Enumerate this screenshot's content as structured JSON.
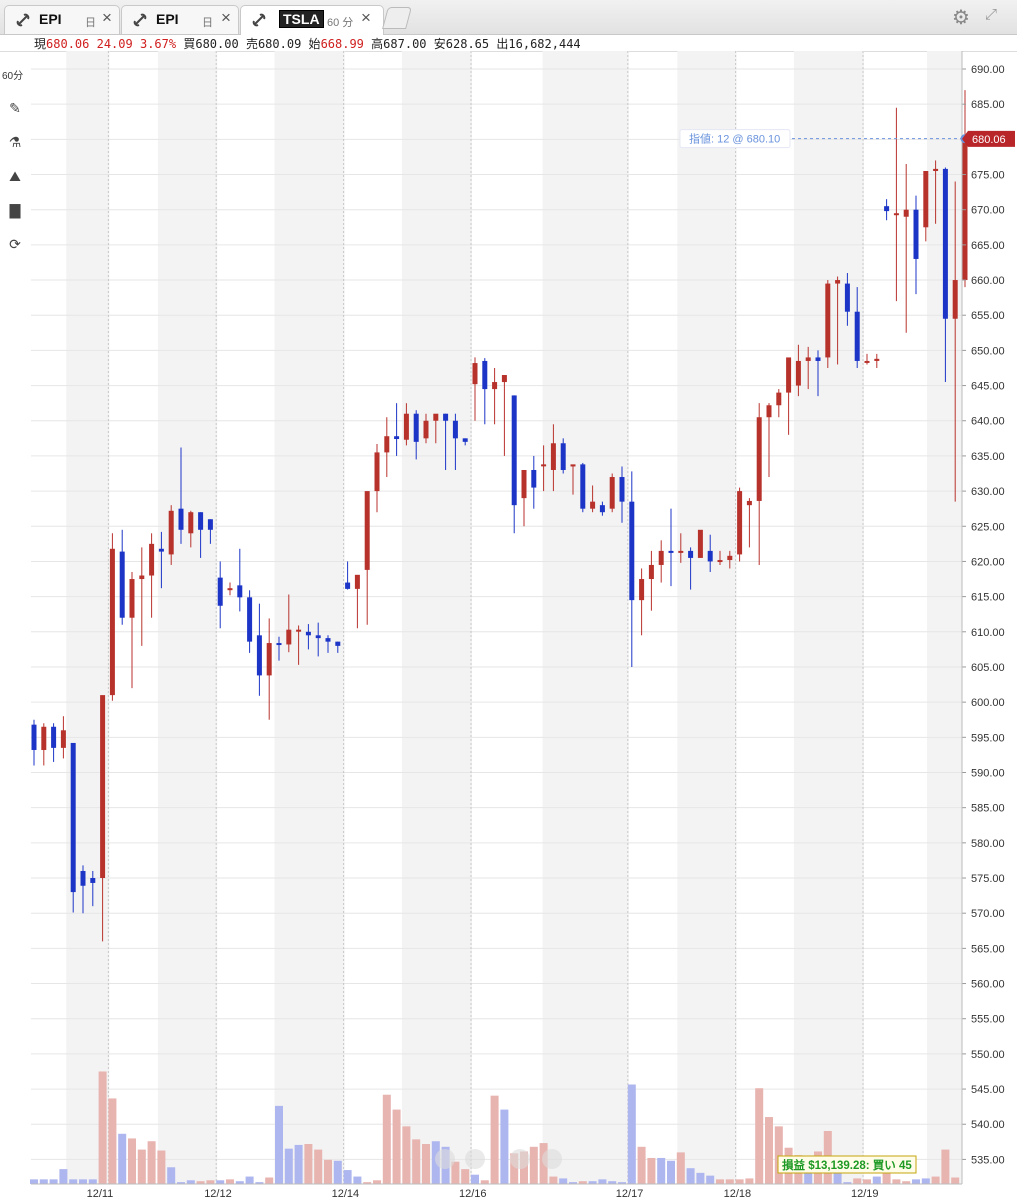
{
  "tabs": [
    {
      "symbol": "EPI",
      "timeframe": "日",
      "active": false
    },
    {
      "symbol": "EPI",
      "timeframe": "日",
      "active": false
    },
    {
      "symbol": "TSLA",
      "timeframe": "60 分",
      "active": true
    }
  ],
  "quote": {
    "last_label": "現",
    "last": "680.06",
    "change": "24.09",
    "change_pct": "3.67%",
    "bid_label": "買",
    "bid": "680.00",
    "ask_label": "売",
    "ask": "680.09",
    "open_label": "始",
    "open": "668.99",
    "high_label": "高",
    "high": "687.00",
    "low_label": "安",
    "low": "628.65",
    "volume_label": "出",
    "volume": "16,682,444"
  },
  "toolbar": {
    "timeframe": "60分"
  },
  "colors": {
    "up": "#b8322c",
    "down": "#1c35c7",
    "vol_up": "#e8b4b0",
    "vol_down": "#aeb6ef",
    "limit": "#6a93dd",
    "price_tag": "#b8262a",
    "pnl": "#1e9a24"
  },
  "order": {
    "label": "指値: 12 @ 680.10",
    "price": 680.1
  },
  "pnl_badge": {
    "text": "損益 $13,139.28: 買い 45"
  },
  "chart_data": {
    "type": "candlestick",
    "timeframe": "60 分",
    "ylim": [
      528,
      692
    ],
    "yticks": [
      535,
      540,
      545,
      550,
      555,
      560,
      565,
      570,
      575,
      580,
      585,
      590,
      595,
      600,
      605,
      610,
      615,
      620,
      625,
      630,
      635,
      640,
      645,
      650,
      655,
      660,
      665,
      670,
      675,
      680,
      685,
      690
    ],
    "last_price": "680.06",
    "x_labels": [
      "12/11",
      "12/12",
      "12/14",
      "12/16",
      "12/17",
      "12/18",
      "12/19"
    ],
    "bars_per_day": 13,
    "candles": [
      [
        596.8,
        597.5,
        591.0,
        593.2
      ],
      [
        593.2,
        597.0,
        591.0,
        596.5
      ],
      [
        596.5,
        597.0,
        591.5,
        593.5
      ],
      [
        593.5,
        598.0,
        592.0,
        596.0
      ],
      [
        594.2,
        594.2,
        570.1,
        573.0
      ],
      [
        576.0,
        576.8,
        570.0,
        573.9
      ],
      [
        575.0,
        576.0,
        571.0,
        574.3
      ],
      [
        575.0,
        600.5,
        566.0,
        601.0
      ],
      [
        601.0,
        624.0,
        600.2,
        621.8
      ],
      [
        621.4,
        624.5,
        611.0,
        612.0
      ],
      [
        612.0,
        618.5,
        602.0,
        617.5
      ],
      [
        617.5,
        622.0,
        608.0,
        618.0
      ],
      [
        618.0,
        624.0,
        612.0,
        622.5
      ],
      [
        621.8,
        624.2,
        616.2,
        621.4
      ],
      [
        621.0,
        628.0,
        619.5,
        627.2
      ],
      [
        627.5,
        636.2,
        622.5,
        624.5
      ],
      [
        624.0,
        627.2,
        622.0,
        627.0
      ],
      [
        627.0,
        627.0,
        620.5,
        624.5
      ],
      [
        626.0,
        626.0,
        622.5,
        624.5
      ],
      [
        617.7,
        620.0,
        610.5,
        613.7
      ],
      [
        616.2,
        617.0,
        615.2,
        616.2
      ],
      [
        616.6,
        621.8,
        612.9,
        614.9
      ],
      [
        614.9,
        615.9,
        607.0,
        608.6
      ],
      [
        609.5,
        614.0,
        600.9,
        603.8
      ],
      [
        603.8,
        611.9,
        597.5,
        608.4
      ],
      [
        608.4,
        609.3,
        605.9,
        608.2
      ],
      [
        608.2,
        615.3,
        607.1,
        610.3
      ],
      [
        610.3,
        610.9,
        605.3,
        610.3
      ],
      [
        610.0,
        611.1,
        607.5,
        609.5
      ],
      [
        609.5,
        611.3,
        606.5,
        609.1
      ],
      [
        609.1,
        609.5,
        607.0,
        608.6
      ],
      [
        608.6,
        608.6,
        607.0,
        608.0
      ],
      [
        617.0,
        620.0,
        616.0,
        616.1
      ],
      [
        616.1,
        617.0,
        610.5,
        618.1
      ],
      [
        618.8,
        620.0,
        611.0,
        630.0
      ],
      [
        630.0,
        636.7,
        627.0,
        635.5
      ],
      [
        635.5,
        640.5,
        632.0,
        637.8
      ],
      [
        637.8,
        642.5,
        635.0,
        637.4
      ],
      [
        637.3,
        642.5,
        636.5,
        641.0
      ],
      [
        641.0,
        641.5,
        634.5,
        637.0
      ],
      [
        637.5,
        641.0,
        636.8,
        640.0
      ],
      [
        640.0,
        640.5,
        636.8,
        641.0
      ],
      [
        641.0,
        641.0,
        633.0,
        640.0
      ],
      [
        640.0,
        641.0,
        633.0,
        637.5
      ],
      [
        637.5,
        637.5,
        636.5,
        637.0
      ],
      [
        645.2,
        649.0,
        640.0,
        648.2
      ],
      [
        648.5,
        648.9,
        639.5,
        644.5
      ],
      [
        644.5,
        647.5,
        639.5,
        645.5
      ],
      [
        645.5,
        646.5,
        635.0,
        646.5
      ],
      [
        643.6,
        643.6,
        624.0,
        628.0
      ],
      [
        629.0,
        630.0,
        625.0,
        633.0
      ],
      [
        633.0,
        635.0,
        627.5,
        630.5
      ],
      [
        633.8,
        636.5,
        630.0,
        633.8
      ],
      [
        633.0,
        639.5,
        630.0,
        636.8
      ],
      [
        636.8,
        637.5,
        632.5,
        633.0
      ],
      [
        633.5,
        633.5,
        629.5,
        633.8
      ],
      [
        633.8,
        634.0,
        627.0,
        627.5
      ],
      [
        627.5,
        630.8,
        627.0,
        628.5
      ],
      [
        628.0,
        628.5,
        626.5,
        627.0
      ],
      [
        627.5,
        632.5,
        627.0,
        632.0
      ],
      [
        632.0,
        633.5,
        625.5,
        628.5
      ],
      [
        628.5,
        632.8,
        605.0,
        614.5
      ],
      [
        614.5,
        619.0,
        609.5,
        617.5
      ],
      [
        617.5,
        621.5,
        613.0,
        619.5
      ],
      [
        619.5,
        623.0,
        617.0,
        621.5
      ],
      [
        621.5,
        627.5,
        616.5,
        621.3
      ],
      [
        621.3,
        624.0,
        619.8,
        621.5
      ],
      [
        621.5,
        622.0,
        616.0,
        620.5
      ],
      [
        620.5,
        623.5,
        620.5,
        624.5
      ],
      [
        621.5,
        623.8,
        618.5,
        620.0
      ],
      [
        620.0,
        621.5,
        619.5,
        620.2
      ],
      [
        620.2,
        621.5,
        619.0,
        620.8
      ],
      [
        621.0,
        630.5,
        620.0,
        630.0
      ],
      [
        628.0,
        629.0,
        622.0,
        628.6
      ],
      [
        628.6,
        642.5,
        619.5,
        640.5
      ],
      [
        640.5,
        642.5,
        632.0,
        642.2
      ],
      [
        642.2,
        644.5,
        640.5,
        644.0
      ],
      [
        644.0,
        647.0,
        638.0,
        649.0
      ],
      [
        645.0,
        650.8,
        643.5,
        648.5
      ],
      [
        648.5,
        650.5,
        644.5,
        649.0
      ],
      [
        649.0,
        650.0,
        643.5,
        648.5
      ],
      [
        649.0,
        660.0,
        647.5,
        659.5
      ],
      [
        659.5,
        660.5,
        648.0,
        660.0
      ],
      [
        659.5,
        661.0,
        653.5,
        655.5
      ],
      [
        655.5,
        659.0,
        647.5,
        648.5
      ],
      [
        648.5,
        649.5,
        648.0,
        648.5
      ],
      [
        648.5,
        649.5,
        647.5,
        648.8
      ],
      [
        670.5,
        671.5,
        668.5,
        669.8
      ],
      [
        669.5,
        684.5,
        657.0,
        669.5
      ],
      [
        669.0,
        676.5,
        652.5,
        670.0
      ],
      [
        670.0,
        672.0,
        658.0,
        663.0
      ],
      [
        667.5,
        675.5,
        665.5,
        675.5
      ],
      [
        675.5,
        677.0,
        668.0,
        675.8
      ],
      [
        675.8,
        676.0,
        645.5,
        654.5
      ],
      [
        654.5,
        674.0,
        628.5,
        660.0
      ],
      [
        660.0,
        687.0,
        659.0,
        680.06
      ]
    ],
    "volume": [
      [
        0.5,
        0
      ],
      [
        0.5,
        0
      ],
      [
        0.5,
        0
      ],
      [
        1.6,
        0
      ],
      [
        0.5,
        0
      ],
      [
        0.5,
        0
      ],
      [
        0.5,
        0
      ],
      [
        12.1,
        1
      ],
      [
        9.2,
        1
      ],
      [
        5.4,
        0
      ],
      [
        4.9,
        1
      ],
      [
        3.7,
        1
      ],
      [
        4.6,
        1
      ],
      [
        3.6,
        1
      ],
      [
        1.8,
        0
      ],
      [
        0.2,
        0
      ],
      [
        0.4,
        0
      ],
      [
        0.3,
        1
      ],
      [
        0.4,
        1
      ],
      [
        0.4,
        0
      ],
      [
        0.5,
        1
      ],
      [
        0.3,
        0
      ],
      [
        0.8,
        0
      ],
      [
        0.2,
        0
      ],
      [
        0.7,
        1
      ],
      [
        8.4,
        0
      ],
      [
        3.8,
        0
      ],
      [
        4.2,
        0
      ],
      [
        4.3,
        1
      ],
      [
        3.7,
        1
      ],
      [
        2.6,
        1
      ],
      [
        2.5,
        0
      ],
      [
        1.5,
        0
      ],
      [
        0.8,
        0
      ],
      [
        0.2,
        1
      ],
      [
        0.4,
        1
      ],
      [
        9.6,
        1
      ],
      [
        8.0,
        1
      ],
      [
        6.2,
        1
      ],
      [
        4.8,
        1
      ],
      [
        4.3,
        1
      ],
      [
        4.6,
        0
      ],
      [
        4.0,
        0
      ],
      [
        2.4,
        1
      ],
      [
        1.6,
        1
      ],
      [
        1.0,
        0
      ],
      [
        0.4,
        1
      ],
      [
        9.5,
        1
      ],
      [
        8.0,
        0
      ],
      [
        3.3,
        1
      ],
      [
        3.5,
        1
      ],
      [
        4.0,
        1
      ],
      [
        4.4,
        1
      ],
      [
        0.8,
        1
      ],
      [
        0.6,
        0
      ],
      [
        0.2,
        0
      ],
      [
        0.3,
        1
      ],
      [
        0.3,
        0
      ],
      [
        0.5,
        0
      ],
      [
        0.3,
        0
      ],
      [
        0.2,
        0
      ],
      [
        10.7,
        0
      ],
      [
        4.0,
        1
      ],
      [
        2.8,
        1
      ],
      [
        2.8,
        0
      ],
      [
        2.5,
        0
      ],
      [
        3.4,
        1
      ],
      [
        1.7,
        0
      ],
      [
        1.2,
        0
      ],
      [
        0.9,
        0
      ],
      [
        0.5,
        1
      ],
      [
        0.5,
        1
      ],
      [
        0.5,
        1
      ],
      [
        0.6,
        1
      ],
      [
        10.3,
        1
      ],
      [
        7.2,
        1
      ],
      [
        6.2,
        1
      ],
      [
        3.9,
        1
      ],
      [
        3.1,
        1
      ],
      [
        2.9,
        0
      ],
      [
        3.5,
        1
      ],
      [
        5.7,
        1
      ],
      [
        2.3,
        0
      ],
      [
        0.2,
        0
      ],
      [
        0.6,
        1
      ],
      [
        0.5,
        1
      ],
      [
        0.8,
        0
      ],
      [
        1.4,
        1
      ],
      [
        0.5,
        1
      ],
      [
        0.3,
        1
      ],
      [
        0.5,
        0
      ],
      [
        0.6,
        0
      ],
      [
        0.8,
        1
      ],
      [
        3.7,
        1
      ],
      [
        0.7,
        1
      ]
    ]
  }
}
